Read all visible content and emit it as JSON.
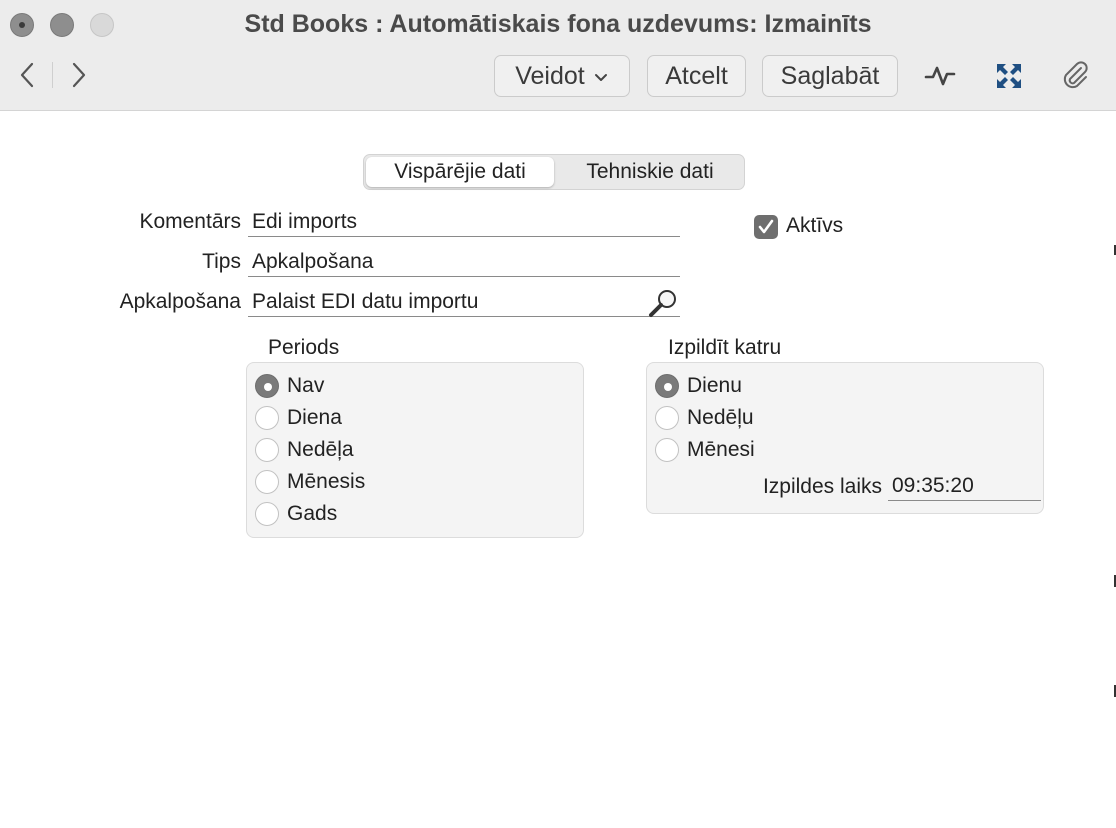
{
  "window": {
    "title": "Std Books : Automātiskais fona uzdevums: Izmainīts"
  },
  "toolbar": {
    "create_label": "Veidot",
    "cancel_label": "Atcelt",
    "save_label": "Saglabāt",
    "icons": [
      "back-icon",
      "forward-icon",
      "chevron-down-icon",
      "activity-icon",
      "expand-icon",
      "paperclip-icon"
    ]
  },
  "tabs": [
    {
      "label": "Vispārējie dati",
      "active": true
    },
    {
      "label": "Tehniskie dati",
      "active": false
    }
  ],
  "form": {
    "comment": {
      "label": "Komentārs",
      "value": "Edi imports"
    },
    "type": {
      "label": "Tips",
      "value": "Apkalpošana"
    },
    "service": {
      "label": "Apkalpošana",
      "value": "Palaist EDI datu importu"
    },
    "active": {
      "label": "Aktīvs",
      "checked": true
    }
  },
  "period": {
    "title": "Periods",
    "options": [
      {
        "label": "Nav",
        "selected": true
      },
      {
        "label": "Diena",
        "selected": false
      },
      {
        "label": "Nedēļa",
        "selected": false
      },
      {
        "label": "Mēnesis",
        "selected": false
      },
      {
        "label": "Gads",
        "selected": false
      }
    ]
  },
  "execute": {
    "title": "Izpildīt katru",
    "options": [
      {
        "label": "Dienu",
        "selected": true
      },
      {
        "label": "Nedēļu",
        "selected": false
      },
      {
        "label": "Mēnesi",
        "selected": false
      }
    ],
    "time_label": "Izpildes laiks",
    "time_value": "09:35:20"
  },
  "colors": {
    "titlebar": "#ececec",
    "radio_selected": "#7a7a7a",
    "group_bg": "#f4f4f4"
  }
}
